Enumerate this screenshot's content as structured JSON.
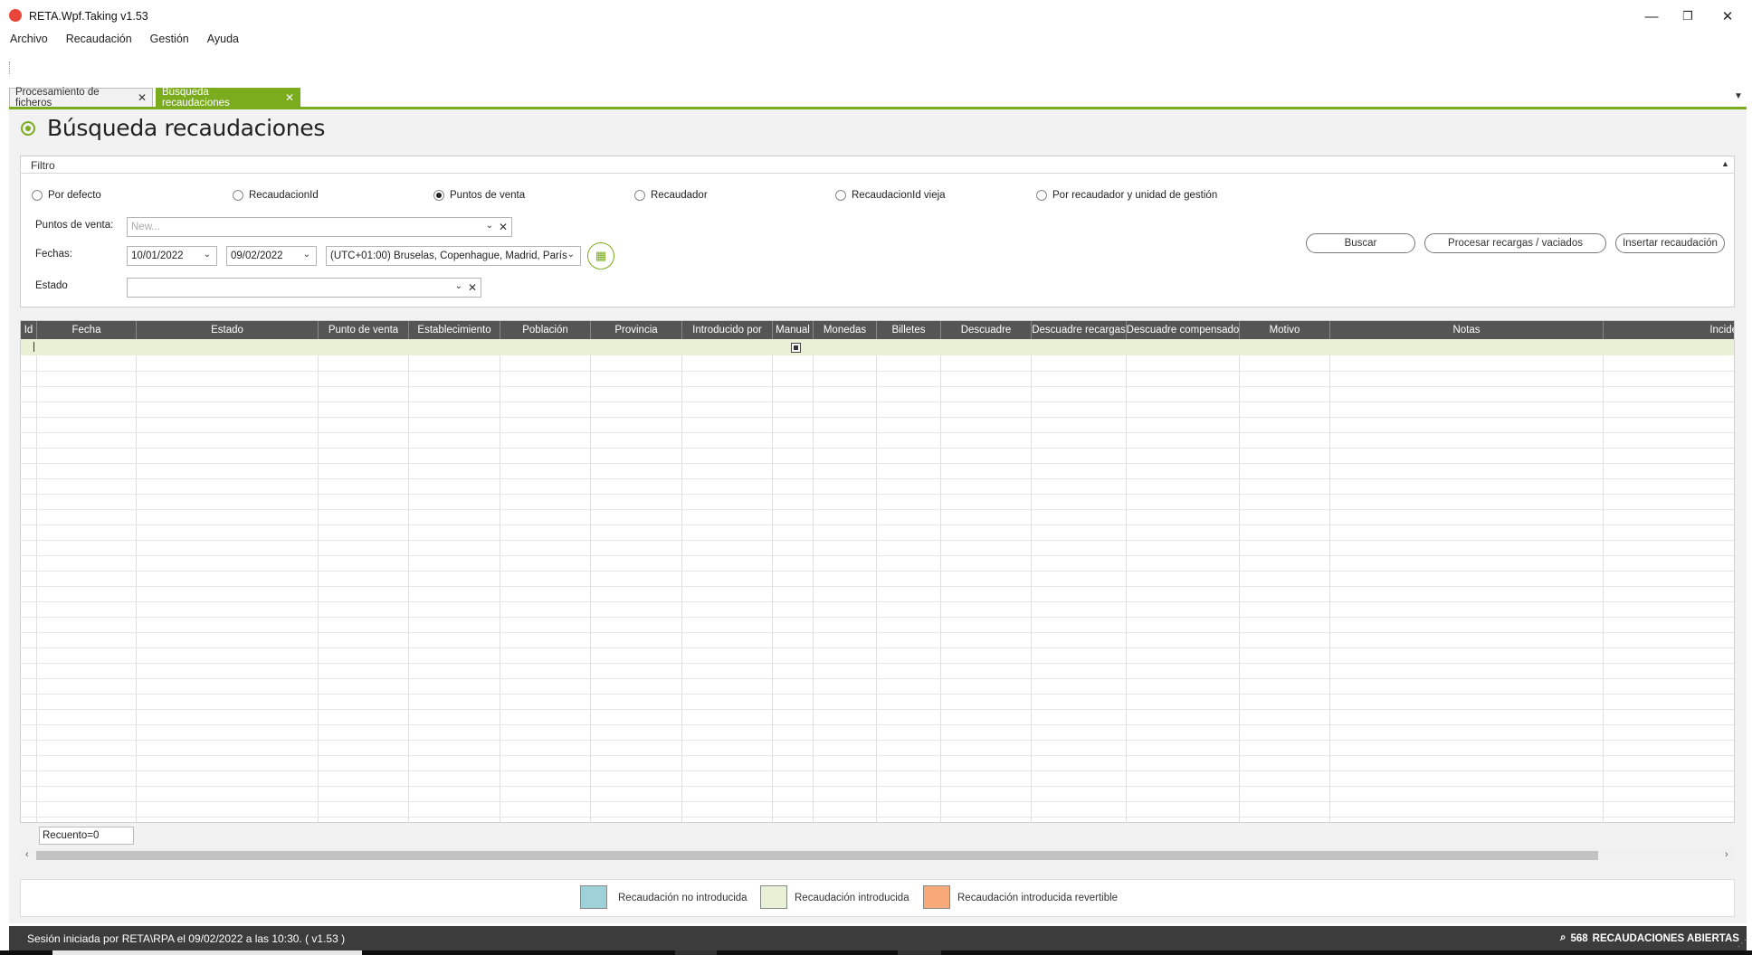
{
  "window": {
    "title": "RETA.Wpf.Taking  v1.53",
    "minimize": "—",
    "restore": "❐",
    "close": "✕"
  },
  "menu": [
    "Archivo",
    "Recaudación",
    "Gestión",
    "Ayuda"
  ],
  "tabs": [
    {
      "label": "Procesamiento de ficheros",
      "close": "✕",
      "active": false
    },
    {
      "label": "Búsqueda recaudaciones",
      "close": "✕",
      "active": true
    }
  ],
  "page_title": "Búsqueda recaudaciones",
  "filter": {
    "title": "Filtro",
    "options": [
      {
        "label": "Por defecto",
        "selected": false
      },
      {
        "label": "RecaudacionId",
        "selected": false
      },
      {
        "label": "Puntos de venta",
        "selected": true
      },
      {
        "label": "Recaudador",
        "selected": false
      },
      {
        "label": "RecaudacionId vieja",
        "selected": false
      },
      {
        "label": "Por recaudador y unidad de gestión",
        "selected": false
      }
    ],
    "puntos_label": "Puntos de venta:",
    "puntos_placeholder": "New...",
    "fechas_label": "Fechas:",
    "fecha_desde": "10/01/2022",
    "fecha_hasta": "09/02/2022",
    "timezone": "(UTC+01:00) Bruselas, Copenhague, Madrid, París",
    "estado_label": "Estado",
    "estado_value": ""
  },
  "buttons": {
    "buscar": "Buscar",
    "procesar": "Procesar recargas / vaciados",
    "insertar": "Insertar recaudación"
  },
  "grid": {
    "columns": [
      "Id",
      "Fecha",
      "Estado",
      "Punto de venta",
      "Establecimiento",
      "Población",
      "Provincia",
      "Introducido por",
      "Manual",
      "Monedas",
      "Billetes",
      "Descuadre",
      "Descuadre recargas",
      "Descuadre compensado",
      "Motivo",
      "Notas",
      "Incide"
    ],
    "rows": [],
    "count": "Recuento=0"
  },
  "legend": [
    {
      "label": "Recaudación no introducida",
      "color": "#9fd2d8"
    },
    {
      "label": "Recaudación introducida",
      "color": "#e8f0d6"
    },
    {
      "label": "Recaudación introducida revertible",
      "color": "#f7a97a"
    }
  ],
  "status": {
    "session": "Sesión iniciada por RETA\\RPA el 09/02/2022 a las 10:30. ( v1.53 )",
    "open_count": "568",
    "open_label": "RECAUDACIONES ABIERTAS"
  },
  "colors": {
    "accent": "#7aac1e",
    "header": "#555555",
    "statusbar": "#3c3c3c"
  }
}
